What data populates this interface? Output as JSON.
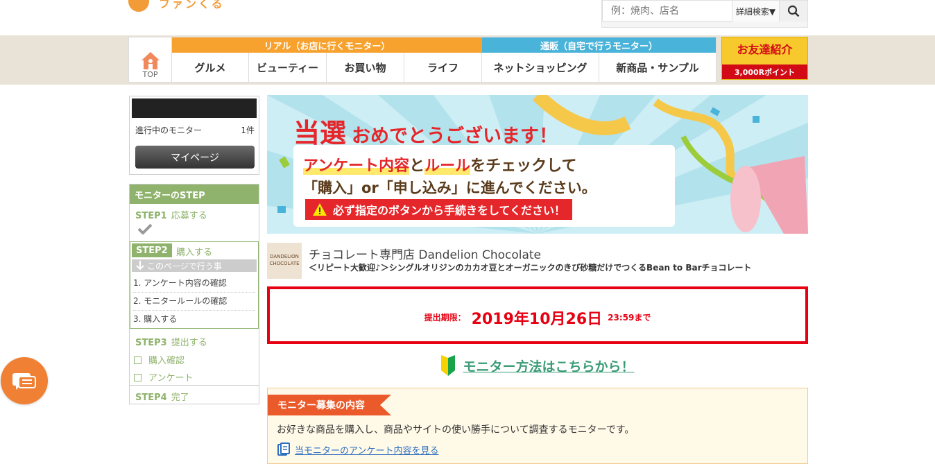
{
  "brand": {
    "logo_text": "ファンくる"
  },
  "search": {
    "placeholder": "例：焼肉、店名",
    "advanced_label": "詳細検索▼"
  },
  "nav": {
    "top_label": "TOP",
    "real": {
      "header": "リアル（お店に行くモニター）",
      "items": [
        "グルメ",
        "ビューティー",
        "お買い物",
        "ライフ"
      ],
      "color": "#f7a22f"
    },
    "online": {
      "header": "通販（自宅で行うモニター）",
      "items": [
        "ネットショッピング",
        "新商品・サンプル"
      ],
      "color": "#4ab3d9"
    },
    "friend": {
      "title": "お友達紹介",
      "points": "3,000Rポイント"
    }
  },
  "user": {
    "progress_label": "進行中のモニター",
    "progress_count": "1件",
    "mypage_label": "マイページ"
  },
  "steps": {
    "header": "モニターのSTEP",
    "step1": {
      "label": "STEP1",
      "text": "応募する"
    },
    "step2": {
      "label": "STEP2",
      "text": "購入する",
      "bar": "このページで行う事",
      "items": [
        "1. アンケート内容の確認",
        "2. モニタールールの確認",
        "3. 購入する"
      ]
    },
    "step3": {
      "label": "STEP3",
      "text": "提出する",
      "checks": [
        "購入確認",
        "アンケート"
      ]
    },
    "step4": {
      "label": "STEP4",
      "text": "完了"
    }
  },
  "banner": {
    "headline_a": "当選",
    "headline_b": "おめでとうございます！",
    "line1_a": "アンケート内容",
    "line1_b": "と",
    "line1_c": "ルール",
    "line1_d": "をチェックして",
    "line2": "「購入」or「申し込み」に進んでください。",
    "warning": "必ず指定のボタンから手続きをしてください！"
  },
  "shop": {
    "logo_text": "DANDELION CHOCOLATE",
    "name": "チョコレート専門店 Dandelion Chocolate",
    "desc": "＜リピート大歓迎♪＞シングルオリジンのカカオ豆とオーガニックのきび砂糖だけでつくるBean to Barチョコレート"
  },
  "deadline": {
    "label": "提出期限：",
    "date": "2019年10月26日",
    "time": "23:59まで"
  },
  "howto": {
    "link": "モニター方法はこちらから！"
  },
  "recruit": {
    "header": "モニター募集の内容",
    "body": "お好きな商品を購入し、商品やサイトの使い勝手について調査するモニターです。",
    "survey_link": "当モニターのアンケート内容を見る"
  }
}
